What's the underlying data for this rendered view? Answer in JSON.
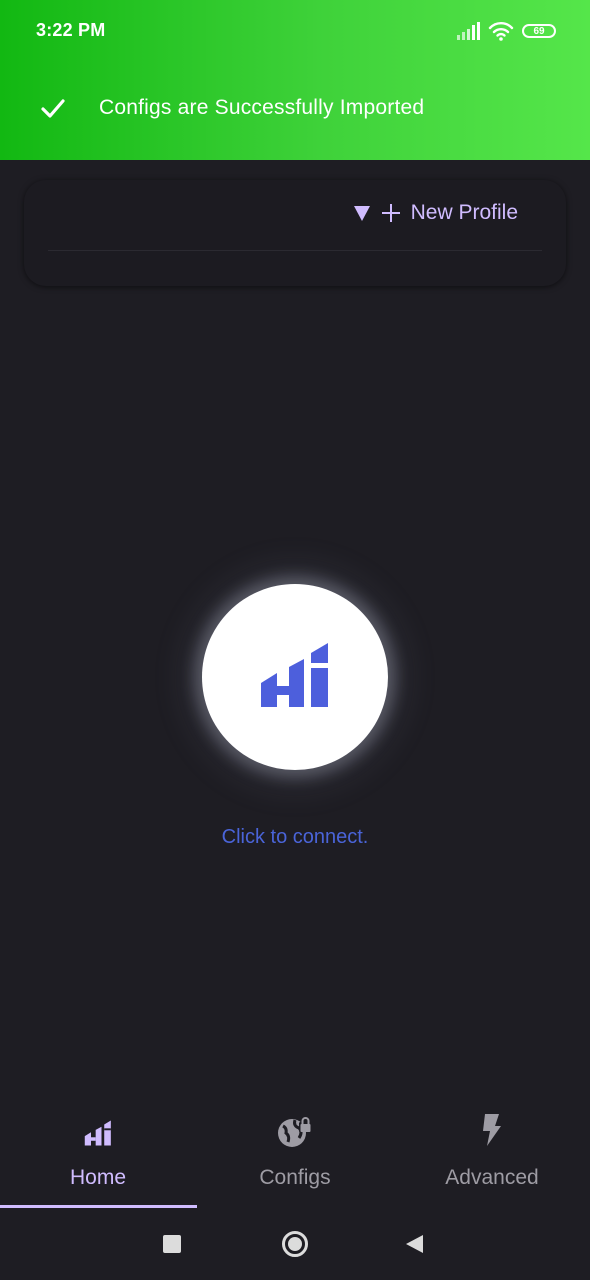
{
  "status_bar": {
    "time": "3:22 PM",
    "battery": "69",
    "icons": [
      "signal-icon",
      "wifi-icon",
      "battery-icon"
    ]
  },
  "toast": {
    "icon": "check-icon",
    "message": "Configs are Successfully Imported",
    "background": "#3fd23a"
  },
  "profile_card": {
    "toggle_icon": "triangle-down-icon",
    "add_icon": "plus-icon",
    "new_profile_label": "New Profile"
  },
  "connect": {
    "icon": "app-logo-icon",
    "hint": "Click to connect."
  },
  "bottom_nav": {
    "items": [
      {
        "label": "Home",
        "icon": "home-signal-icon",
        "active": true
      },
      {
        "label": "Configs",
        "icon": "globe-lock-icon",
        "active": false
      },
      {
        "label": "Advanced",
        "icon": "bolt-icon",
        "active": false
      }
    ]
  },
  "colors": {
    "background": "#1e1d23",
    "accent": "#d0bcff",
    "connect_text": "#4a64d8",
    "logo": "#4d5fdc",
    "inactive_nav": "#9e9ca4"
  }
}
